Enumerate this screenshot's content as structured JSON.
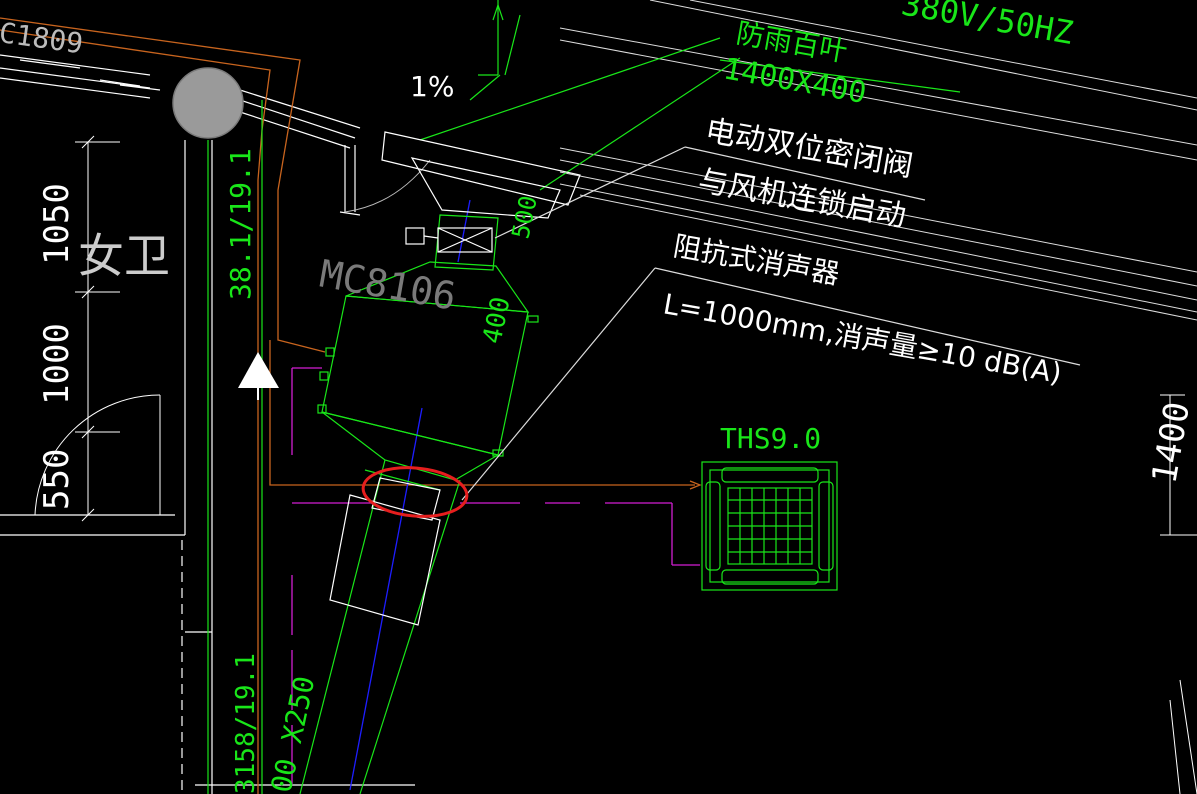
{
  "colors": {
    "background": "#000000",
    "white": "#ffffff",
    "green": "#19e619",
    "orange": "#c8641e",
    "magenta": "#d21ed2",
    "blue": "#1e1eff",
    "gray": "#9a9a9a",
    "dark_gray": "#7a7a7a",
    "leader": "#dcdcdc",
    "red": "#e61e1e"
  },
  "labels": {
    "top_code": "C1809",
    "slope": "1%",
    "room": "女卫",
    "dim_1050": "1050",
    "dim_1000": "1000",
    "dim_550": "550",
    "dim_right": "1400",
    "pipe_upper": "38.1/19.1",
    "pipe_lower": "3158/19.1",
    "duct_lower": "00 X250",
    "duct_vertical": "400",
    "duct_top": "500",
    "power": "380V/50HZ",
    "louver_title": "防雨百叶",
    "louver_size": "1400X400",
    "valve_line1": "电动双位密闭阀",
    "valve_line2": "与风机连锁启动",
    "silencer_line1": "阻抗式消声器",
    "silencer_line2": "L=1000mm,消声量≥10 dB(A)",
    "fan_model": "MC8106",
    "unit_label": "THS9.0"
  },
  "icons": {
    "flow_arrow": "flow-arrow-up-icon",
    "riser": "riser-circle-icon",
    "damper": "damper-x-icon",
    "cassette": "cassette-unit-icon",
    "highlight": "highlight-ellipse-icon"
  }
}
